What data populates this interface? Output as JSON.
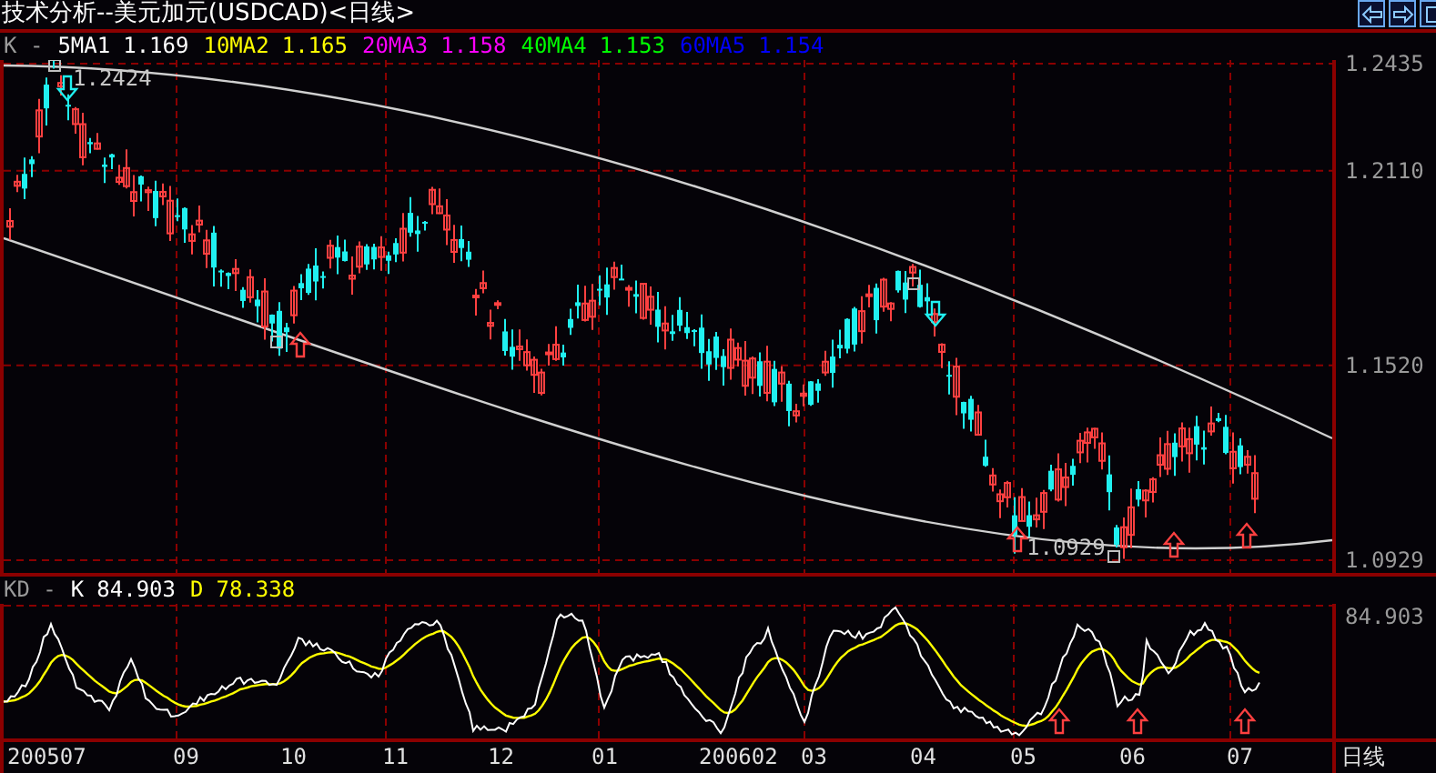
{
  "window": {
    "title": "技术分析--美元加元(USDCAD)<日线>"
  },
  "nav_buttons": [
    {
      "kind": "left"
    },
    {
      "kind": "right"
    },
    {
      "kind": "window"
    }
  ],
  "price_panel": {
    "indicator": "K -",
    "moving_averages": [
      {
        "label": "5MA1",
        "value": "1.169",
        "color": "#ffffff"
      },
      {
        "label": "10MA2",
        "value": "1.165",
        "color": "#ffff00"
      },
      {
        "label": "20MA3",
        "value": "1.158",
        "color": "#ff00ff"
      },
      {
        "label": "40MA4",
        "value": "1.153",
        "color": "#00ff00"
      },
      {
        "label": "60MA5",
        "value": "1.154",
        "color": "#0000ff"
      }
    ],
    "axis_labels": [
      "1.2435",
      "1.2110",
      "1.1520",
      "1.0929"
    ],
    "high_label": "1.2424",
    "low_label": "1.0929"
  },
  "kd_panel": {
    "indicator": "KD -",
    "lines": [
      {
        "label": "K",
        "value": "84.903",
        "color": "#ffffff"
      },
      {
        "label": "D",
        "value": "78.338",
        "color": "#ffff00"
      }
    ],
    "axis_label": "84.903"
  },
  "time_axis": {
    "labels": [
      "200507",
      "09",
      "10",
      "11",
      "12",
      "01",
      "200602",
      "03",
      "04",
      "05",
      "06",
      "07"
    ],
    "period": "日线"
  }
}
